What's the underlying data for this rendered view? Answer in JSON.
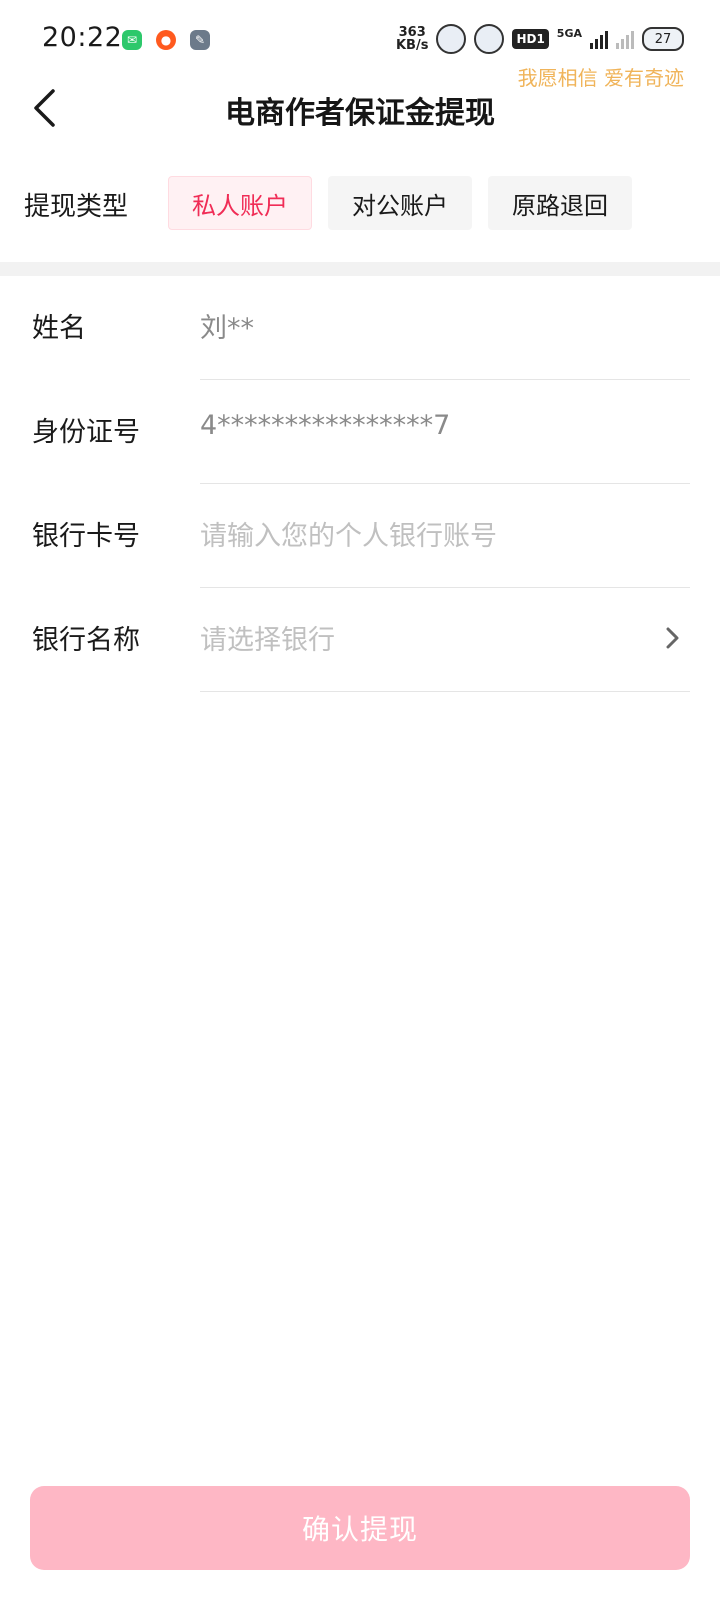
{
  "status_bar": {
    "time": "20:22",
    "net_speed_value": "363",
    "net_speed_unit": "KB/s",
    "hd_badge": "HD1",
    "network_type": "5GA",
    "battery": "27",
    "slogan": "我愿相信 爱有奇迹"
  },
  "header": {
    "title": "电商作者保证金提现"
  },
  "withdraw_type": {
    "label": "提现类型",
    "tabs": [
      {
        "label": "私人账户",
        "active": true
      },
      {
        "label": "对公账户",
        "active": false
      },
      {
        "label": "原路退回",
        "active": false
      }
    ]
  },
  "form": {
    "name": {
      "label": "姓名",
      "value": "刘**"
    },
    "id_number": {
      "label": "身份证号",
      "value": "4****************7"
    },
    "bank_card": {
      "label": "银行卡号",
      "placeholder": "请输入您的个人银行账号"
    },
    "bank_name": {
      "label": "银行名称",
      "placeholder": "请选择银行"
    }
  },
  "confirm_button": {
    "label": "确认提现",
    "color": "#feb7c5"
  },
  "colors": {
    "accent": "#f02d56",
    "active_tab_bg": "#fff1f3",
    "slogan": "#f0b45a"
  }
}
